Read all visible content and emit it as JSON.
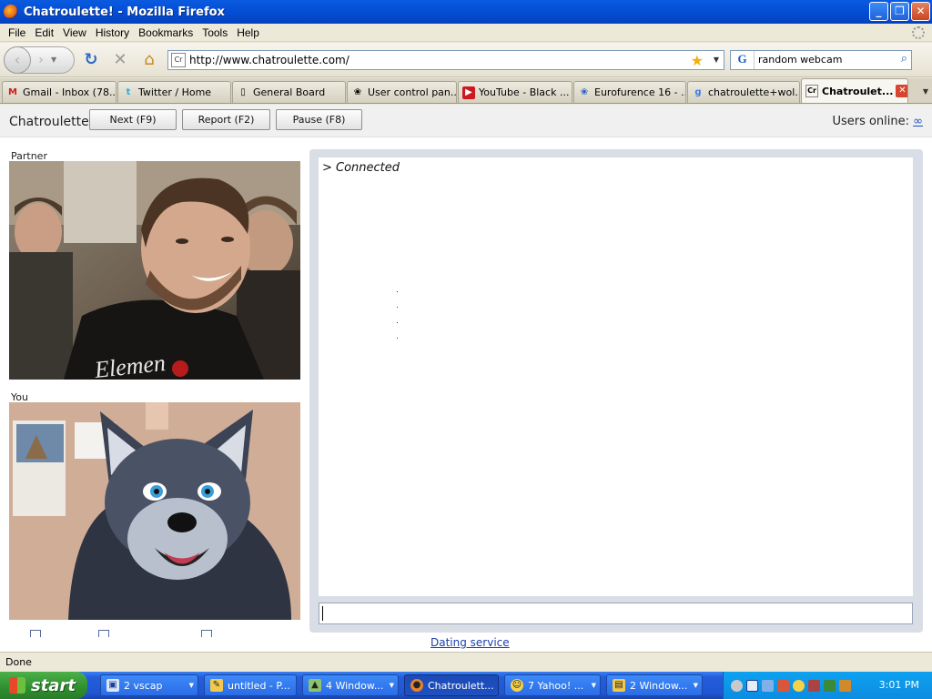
{
  "window": {
    "title": "Chatroulette! - Mozilla Firefox",
    "buttons": {
      "minimize": "_",
      "maximize": "❒",
      "close": "✕"
    }
  },
  "menu": [
    "File",
    "Edit",
    "View",
    "History",
    "Bookmarks",
    "Tools",
    "Help"
  ],
  "navbar": {
    "url": "http://www.chatroulette.com/",
    "url_favicon": "Cr",
    "search_engine": "G",
    "search_value": "random webcam"
  },
  "tabs": [
    {
      "label": "Gmail - Inbox (78...",
      "icon": "M"
    },
    {
      "label": "Twitter / Home",
      "icon": "t"
    },
    {
      "label": "General Board",
      "icon": "▯"
    },
    {
      "label": "User control pan...",
      "icon": "❀"
    },
    {
      "label": "YouTube - Black ...",
      "icon": "▶"
    },
    {
      "label": "Eurofurence 16 - ...",
      "icon": "❀"
    },
    {
      "label": "chatroulette+wol...",
      "icon": "g"
    },
    {
      "label": "Chatroulet...",
      "icon": "Cr",
      "active": true
    }
  ],
  "page": {
    "brand": "Chatroulette",
    "buttons": {
      "next": "Next (F9)",
      "report": "Report (F2)",
      "pause": "Pause (F8)"
    },
    "users_online_label": "Users online:",
    "users_online_value": "∞",
    "partner_label": "Partner",
    "you_label": "You",
    "chat_line": "> Connected",
    "dating_link": "Dating service"
  },
  "statusbar": {
    "text": "Done"
  },
  "taskbar": {
    "start": "start",
    "tasks": [
      {
        "label": "2 vscap",
        "icon": "▣"
      },
      {
        "label": "untitled - P...",
        "icon": "✎"
      },
      {
        "label": "4 Window...",
        "icon": "▲"
      },
      {
        "label": "Chatroulett...",
        "icon": "●",
        "active": true
      },
      {
        "label": "7 Yahoo! ...",
        "icon": "☺"
      },
      {
        "label": "2 Window...",
        "icon": "▤"
      }
    ],
    "clock": "3:01 PM"
  },
  "colors": {
    "titlebar": "#0A5BE0",
    "taskbar": "#245DDB",
    "start": "#2F8E2E",
    "tray": "#0C8CE0",
    "link": "#1A3FA8"
  }
}
